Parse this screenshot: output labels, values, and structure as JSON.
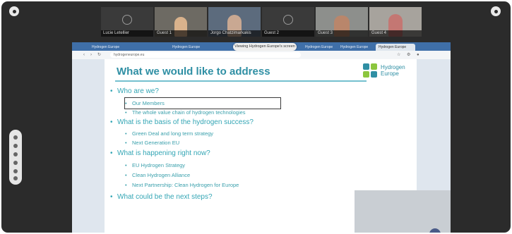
{
  "participants": [
    {
      "name": "Lucie Letellier",
      "type": "avatar"
    },
    {
      "name": "Guest 1",
      "type": "video"
    },
    {
      "name": "Jorgo Chatzimarkakis",
      "type": "video"
    },
    {
      "name": "Guest 2",
      "type": "avatar"
    },
    {
      "name": "Guest 3",
      "type": "video"
    },
    {
      "name": "Guest 4",
      "type": "video"
    }
  ],
  "screen_share": {
    "sharing_label": "Viewing Hydrogen Europe's screen",
    "tabs": [
      "Hydrogen Europe",
      "Hydrogen Europe",
      "Hydrogen Europe",
      "Hydrogen Europe",
      "Hydrogen Europe"
    ],
    "url": "hydrogeneurope.eu"
  },
  "slide": {
    "title": "What we would like to address",
    "logo": {
      "line1": "Hydrogen",
      "line2": "Europe"
    },
    "bullets": [
      {
        "text": "Who are we?",
        "level": 1
      },
      {
        "text": "Our Members",
        "level": 2
      },
      {
        "text": "The whole value chain of hydrogen technologies",
        "level": 2
      },
      {
        "text": "What is the basis of the hydrogen success?",
        "level": 1
      },
      {
        "text": "Green Deal and long term strategy",
        "level": 2
      },
      {
        "text": "Next Generation EU",
        "level": 2
      },
      {
        "text": "What is happening right now?",
        "level": 1
      },
      {
        "text": "EU Hydrogen Strategy",
        "level": 2
      },
      {
        "text": "Clean Hydrogen Alliance",
        "level": 2
      },
      {
        "text": "Next Partnership: Clean Hydrogen for Europe",
        "level": 2
      },
      {
        "text": "What could be the next steps?",
        "level": 1
      }
    ]
  },
  "icons": {
    "left_corner": "settings-icon",
    "right_corner": "settings-icon",
    "logo": "hydrogen-europe-logo-icon"
  },
  "colors": {
    "title": "#2f8fa4",
    "bullet": "#34a6b5",
    "frame": "#2b2b2b",
    "browser_tab": "#3f6fa8"
  }
}
